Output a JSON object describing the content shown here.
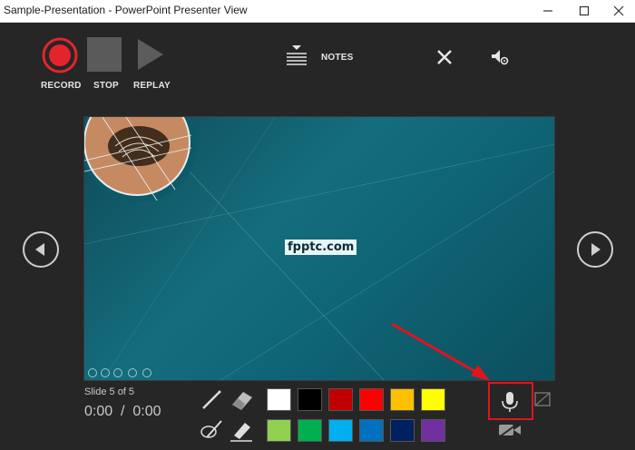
{
  "window": {
    "title": "Sample-Presentation - PowerPoint Presenter View"
  },
  "toolbar": {
    "record_label": "RECORD",
    "stop_label": "STOP",
    "replay_label": "REPLAY",
    "notes_label": "NOTES",
    "record_color": "#e3252b"
  },
  "slide": {
    "logo_text": "fpptc.com",
    "background_color": "#126474"
  },
  "status": {
    "slide_counter": "Slide 5 of 5",
    "timer": "0:00  /  0:00"
  },
  "ink": {
    "colors": [
      "#ffffff",
      "#000000",
      "#c00000",
      "#ff0000",
      "#ffc000",
      "#ffff00",
      "#92d050",
      "#00b050",
      "#00b0f0",
      "#0070c0",
      "#002060",
      "#7030a0"
    ]
  },
  "highlight": {
    "annotation_color": "#e3131b",
    "target": "microphone"
  },
  "icons": [
    "minimize-icon",
    "maximize-icon",
    "close-icon",
    "notes-icon",
    "cancel-icon",
    "settings-icon",
    "previous-icon",
    "next-icon",
    "pen-icon",
    "eraser-icon",
    "lasso-pen-icon",
    "highlighter-icon",
    "microphone-icon",
    "camera-off-icon",
    "camera-mode-icon"
  ]
}
